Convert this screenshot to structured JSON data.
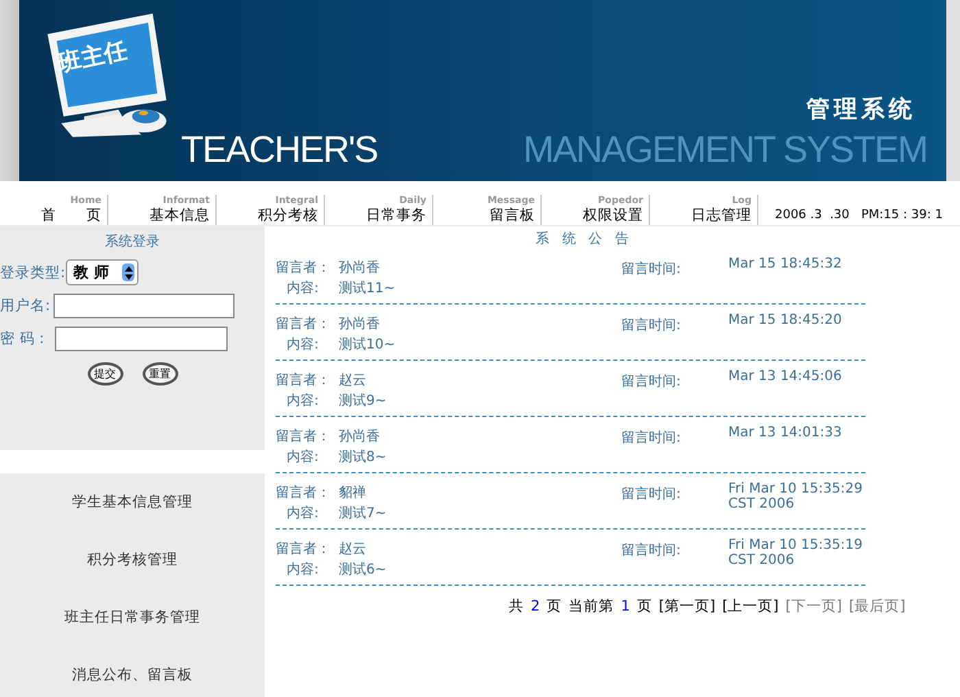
{
  "banner": {
    "screen_text": "班主任",
    "brand": "TEACHER'S",
    "subtitle_cn": "管理系统",
    "subtitle_en": "MANAGEMENT SYSTEM"
  },
  "nav": {
    "items": [
      {
        "en": "Home",
        "cn": "首　　页"
      },
      {
        "en": "Informat",
        "cn": "基本信息"
      },
      {
        "en": "Integral",
        "cn": "积分考核"
      },
      {
        "en": "Daily",
        "cn": "日常事务"
      },
      {
        "en": "Message",
        "cn": "留言板"
      },
      {
        "en": "Popedor",
        "cn": "权限设置"
      },
      {
        "en": "Log",
        "cn": "日志管理"
      }
    ],
    "datetime": "2006 .3  .30   PM:15 : 39: 1"
  },
  "login": {
    "title": "系统登录",
    "type_label": "登录类型:",
    "type_value": "教 师",
    "user_label": "用户名:",
    "password_label": "密 码 :",
    "buttons": [
      "提交",
      "重置"
    ]
  },
  "sidebar": {
    "items": [
      "学生基本信息管理",
      "积分考核管理",
      "班主任日常事务管理",
      "消息公布、留言板"
    ]
  },
  "notices": {
    "title": "系 统 公 告",
    "messages": [
      {
        "author_label": "留言者：",
        "author": "孙尚香",
        "time_label": "留言时间:",
        "time": "Mar 15 18:45:32",
        "content_label": "内容:",
        "content": "测试11~"
      },
      {
        "author_label": "留言者：",
        "author": "孙尚香",
        "time_label": "留言时间:",
        "time": "Mar 15 18:45:20",
        "content_label": "内容:",
        "content": "测试10~"
      },
      {
        "author_label": "留言者：",
        "author": "赵云",
        "time_label": "留言时间:",
        "time": "Mar 13 14:45:06",
        "content_label": "内容:",
        "content": "测试9~"
      },
      {
        "author_label": "留言者：",
        "author": "孙尚香",
        "time_label": "留言时间:",
        "time": "Mar 13 14:01:33",
        "content_label": "内容:",
        "content": "测试8~"
      },
      {
        "author_label": "留言者：",
        "author": "貂禅",
        "time_label": "留言时间:",
        "time": "Fri Mar 10 15:35:29 CST 2006",
        "content_label": "内容:",
        "content": "测试7~"
      },
      {
        "author_label": "留言者：",
        "author": "赵云",
        "time_label": "留言时间:",
        "time": "Fri Mar 10 15:35:19 CST 2006",
        "content_label": "内容:",
        "content": "测试6~"
      }
    ],
    "pager": [
      {
        "kind": "text",
        "text": "共"
      },
      {
        "kind": "number",
        "text": "2"
      },
      {
        "kind": "text",
        "text": "页"
      },
      {
        "kind": "text",
        "text": "当前第"
      },
      {
        "kind": "number",
        "text": "1"
      },
      {
        "kind": "text",
        "text": "页"
      },
      {
        "kind": "link",
        "text": "[第一页]",
        "disabled": false
      },
      {
        "kind": "link",
        "text": "[上一页]",
        "disabled": false
      },
      {
        "kind": "link",
        "text": "[下一页]",
        "disabled": true
      },
      {
        "kind": "link",
        "text": "[最后页]",
        "disabled": true
      }
    ]
  }
}
